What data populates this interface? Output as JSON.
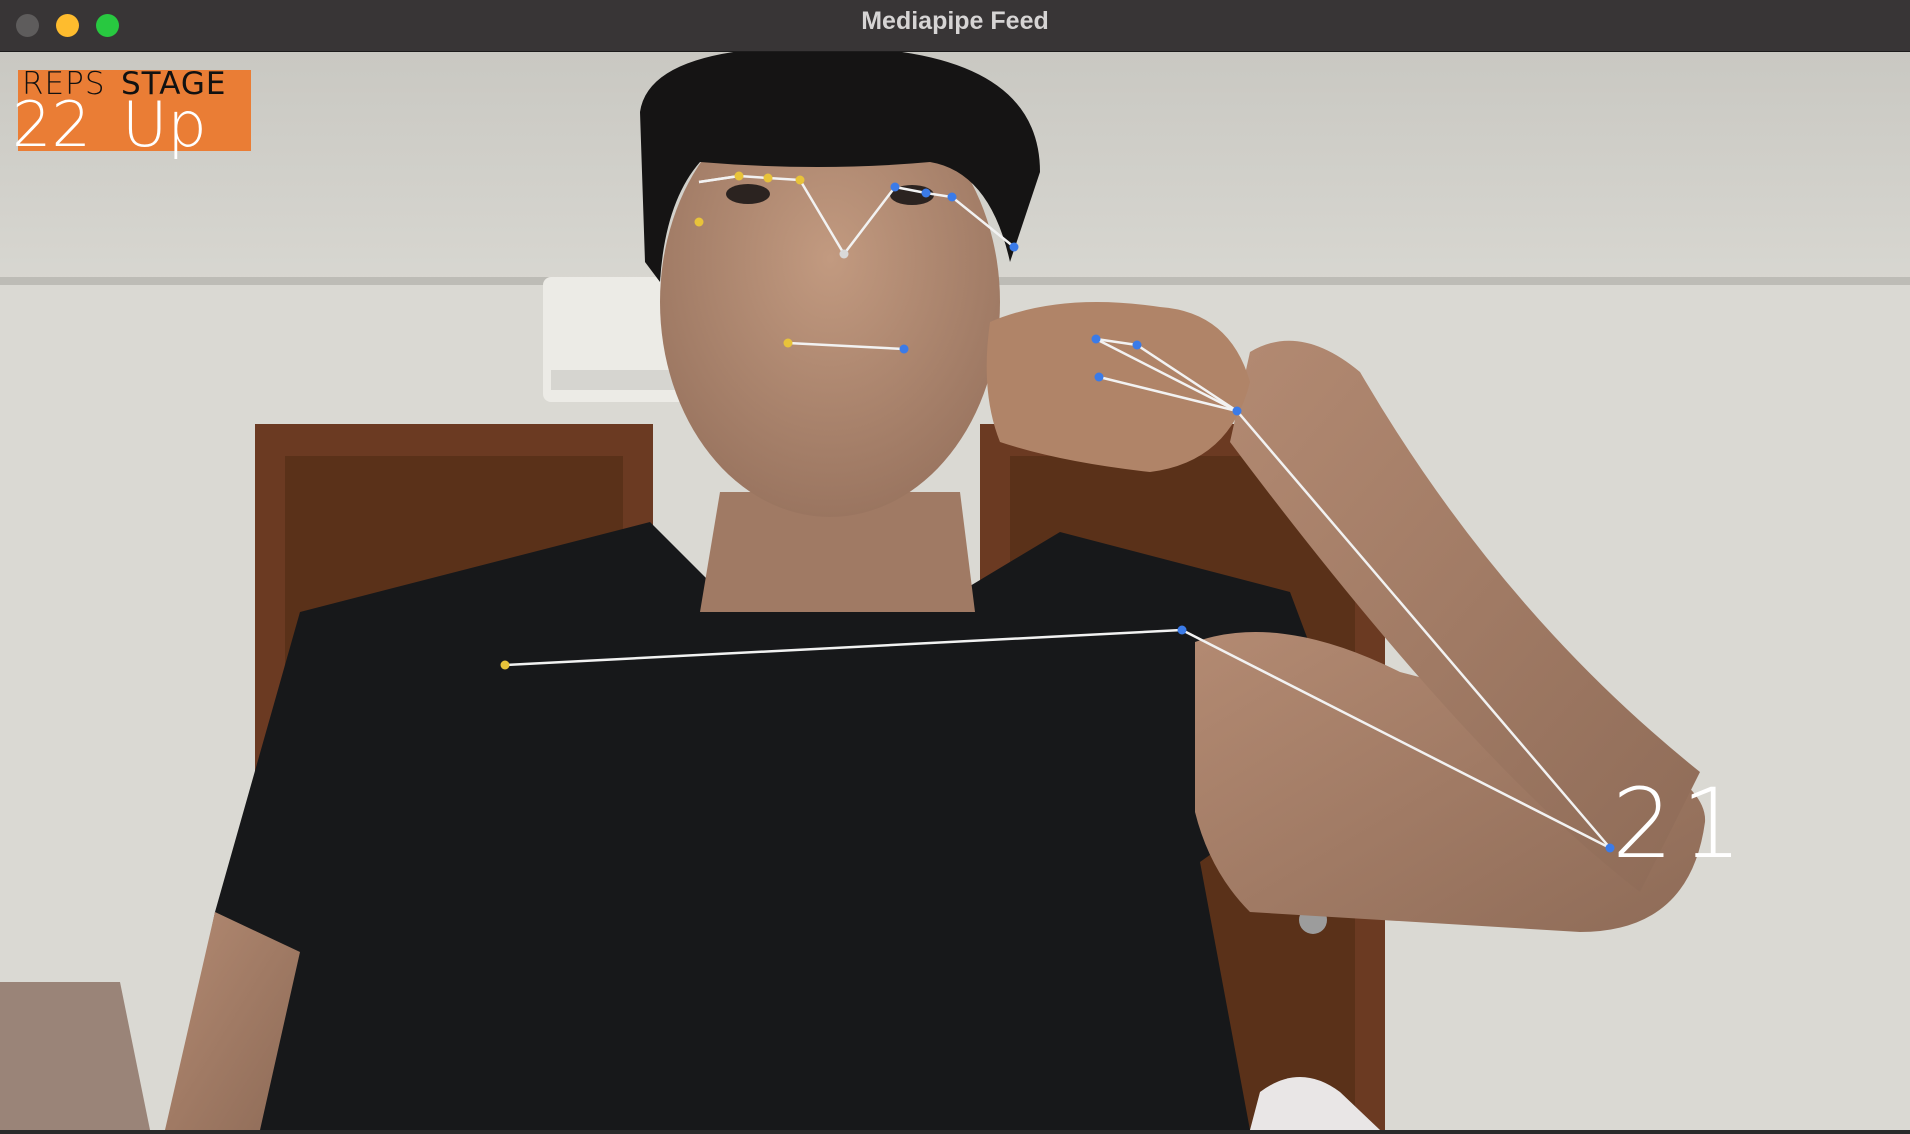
{
  "window": {
    "title": "Mediapipe Feed",
    "buttons": {
      "close": "close-button",
      "minimize": "minimize-button",
      "maximize": "maximize-button"
    }
  },
  "overlay": {
    "reps_label": "REPS",
    "stage_label": "STAGE",
    "reps_value": "22",
    "stage_value": "Up",
    "box_color": "#ea7d35",
    "angle_value": "21"
  },
  "landmark_colors": {
    "left": "#e8c33a",
    "right": "#3b7be8",
    "center": "#d9d9d9",
    "connection": "#f2f2f2"
  }
}
